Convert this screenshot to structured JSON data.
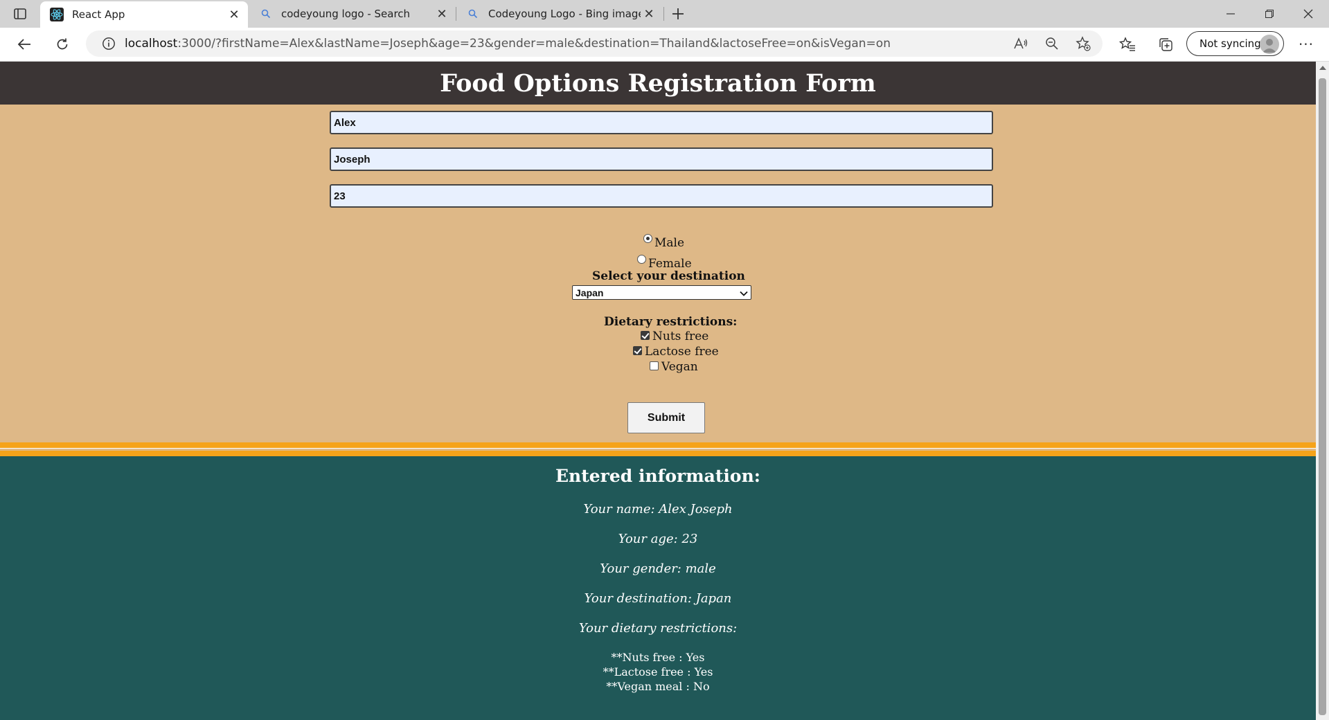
{
  "browser": {
    "tabs": [
      {
        "title": "React App",
        "icon": "react-icon",
        "active": true
      },
      {
        "title": "codeyoung logo - Search",
        "icon": "search-icon",
        "active": false
      },
      {
        "title": "Codeyoung Logo - Bing images",
        "icon": "search-icon",
        "active": false
      }
    ],
    "url_host": "localhost",
    "url_rest": ":3000/?firstName=Alex&lastName=Joseph&age=23&gender=male&destination=Thailand&lactoseFree=on&isVegan=on",
    "sync_label": "Not syncing"
  },
  "page": {
    "title": "Food Options Registration Form",
    "colors": {
      "header_bg": "#3b3535",
      "form_bg": "#deb887",
      "stripe": "#f5a31a",
      "results_bg": "#205858",
      "input_bg": "#e8f0fe"
    }
  },
  "form": {
    "first_name": "Alex",
    "last_name": "Joseph",
    "age": "23",
    "gender_options": [
      {
        "label": "Male",
        "checked": true
      },
      {
        "label": "Female",
        "checked": false
      }
    ],
    "destination_label": "Select your destination",
    "destination_value": "Japan",
    "dietary_label": "Dietary restrictions:",
    "dietary_options": [
      {
        "label": "Nuts free",
        "checked": true
      },
      {
        "label": "Lactose free",
        "checked": true
      },
      {
        "label": "Vegan",
        "checked": false
      }
    ],
    "submit_label": "Submit"
  },
  "results": {
    "heading": "Entered information:",
    "name_line": "Your name: Alex Joseph",
    "age_line": "Your age: 23",
    "gender_line": "Your gender: male",
    "destination_line": "Your destination: Japan",
    "dietary_line": "Your dietary restrictions:",
    "diet_items": [
      "**Nuts free : Yes",
      "**Lactose free : Yes",
      "**Vegan meal : No"
    ]
  }
}
